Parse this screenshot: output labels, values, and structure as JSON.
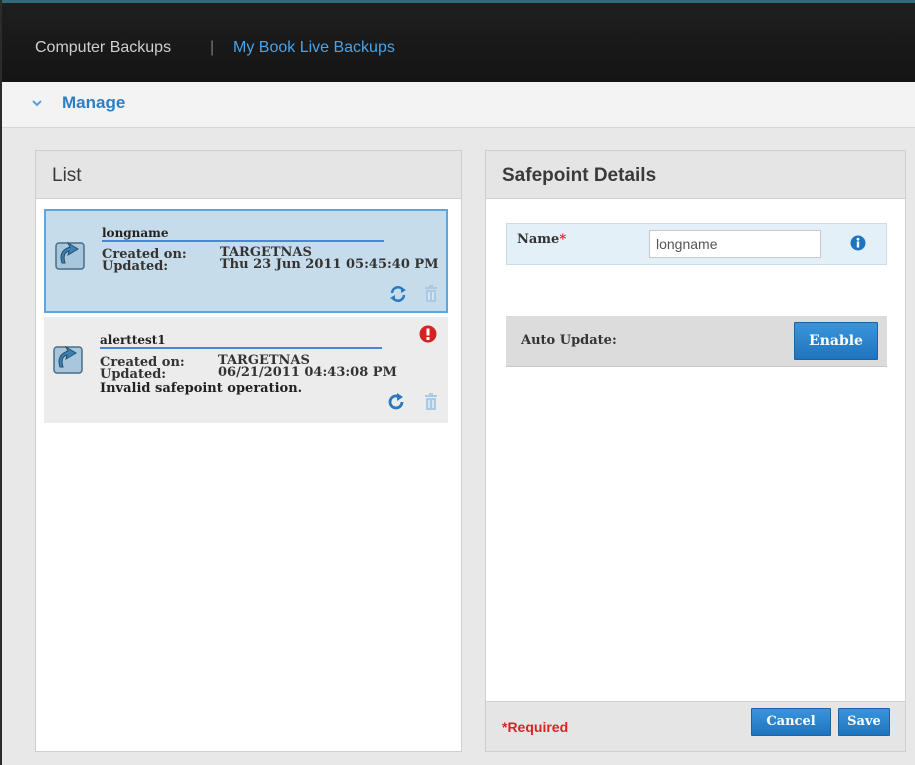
{
  "nav": {
    "tabs": [
      {
        "label": "Computer Backups",
        "active": false
      },
      {
        "label": "My Book Live Backups",
        "active": true
      }
    ],
    "separator": "|"
  },
  "manage": {
    "title": "Manage",
    "icon": "chevron-down-icon"
  },
  "list_panel": {
    "title": "List",
    "items": [
      {
        "name": "longname",
        "created_label": "Created on:",
        "created_value": "TARGETNAS",
        "updated_label": "Updated:",
        "updated_value": "Thu 23 Jun 2011 05:45:40 PM",
        "selected": true,
        "action_icon": "sync-icon",
        "error": ""
      },
      {
        "name": "alerttest1",
        "created_label": "Created on:",
        "created_value": "TARGETNAS",
        "updated_label": "Updated:",
        "updated_value": "06/21/2011 04:43:08 PM",
        "selected": false,
        "action_icon": "refresh-icon",
        "error": "Invalid safepoint operation."
      }
    ]
  },
  "details": {
    "title": "Safepoint Details",
    "name_label": "Name",
    "required_mark": "*",
    "name_value": "longname",
    "auto_update_label": "Auto Update:",
    "enable_label": "Enable",
    "required_note": "*Required",
    "cancel_label": "Cancel",
    "save_label": "Save"
  },
  "colors": {
    "accent": "#2a7fc6",
    "selected_bg": "#c7dcea",
    "button": "#1f74bd",
    "error": "#d22222"
  }
}
